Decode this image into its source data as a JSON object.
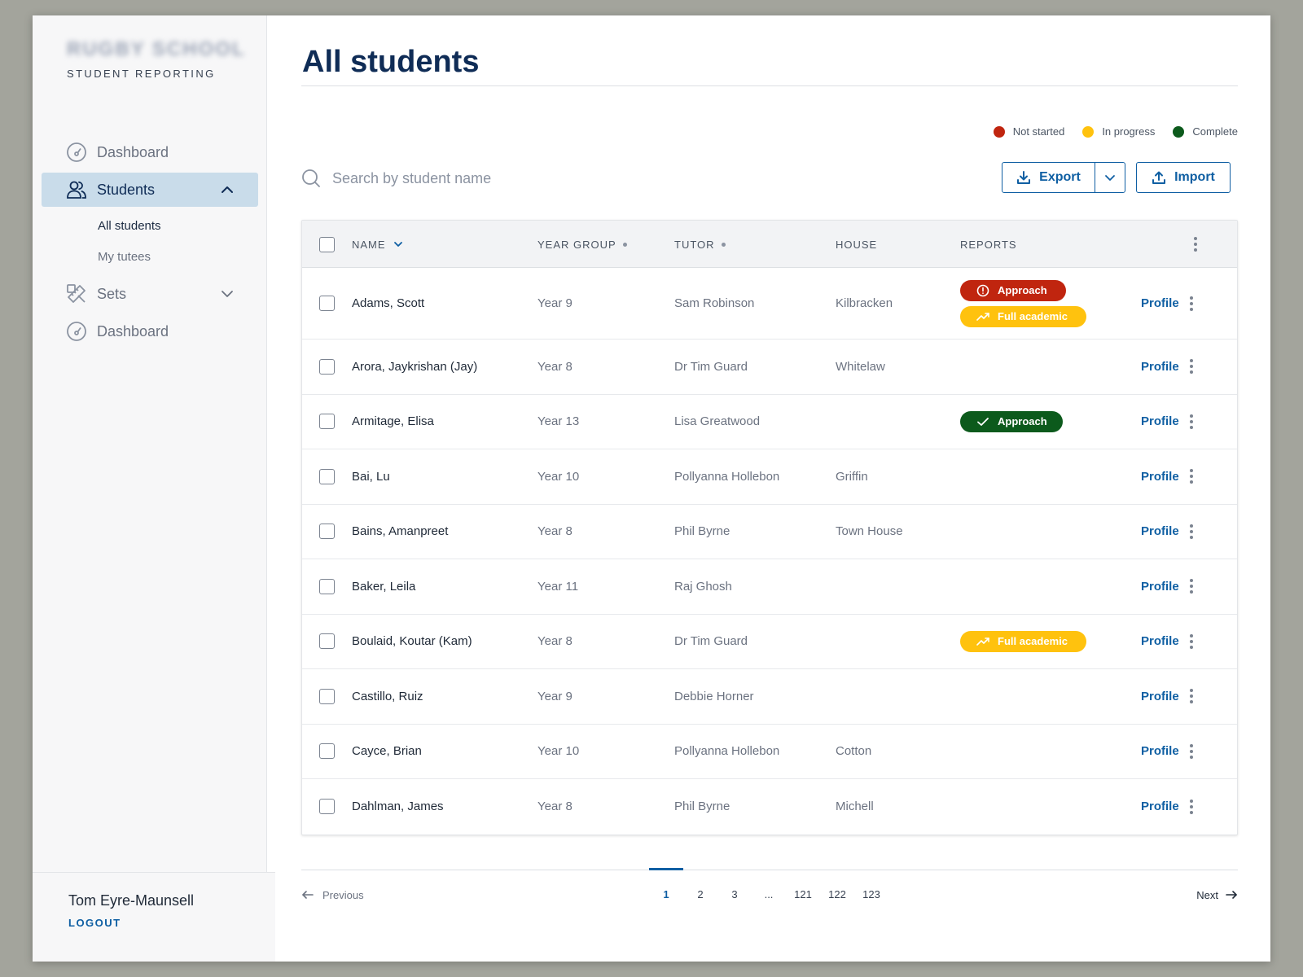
{
  "sidebar": {
    "brand_logo": "RUGBY SCHOOL",
    "brand_subtitle": "STUDENT REPORTING",
    "items": [
      {
        "label": "Dashboard",
        "icon": "gauge-icon"
      },
      {
        "label": "Students",
        "icon": "users-icon",
        "expanded": true
      },
      {
        "label": "Sets",
        "icon": "pencil-ruler-icon",
        "expanded": false
      },
      {
        "label": "Dashboard",
        "icon": "gauge-icon"
      }
    ],
    "sub_items": [
      {
        "label": "All students",
        "active": true
      },
      {
        "label": "My tutees",
        "active": false
      }
    ],
    "user_name": "Tom Eyre-Maunsell",
    "logout_label": "LOGOUT"
  },
  "main": {
    "title": "All students",
    "legend": [
      {
        "label": "Not started",
        "color": "#c0250f"
      },
      {
        "label": "In progress",
        "color": "#ffc20e"
      },
      {
        "label": "Complete",
        "color": "#0c5a1c"
      }
    ],
    "search_placeholder": "Search by student name",
    "export_label": "Export",
    "import_label": "Import",
    "columns": {
      "name": "NAME",
      "year_group": "YEAR GROUP",
      "tutor": "TUTOR",
      "house": "HOUSE",
      "reports": "REPORTS"
    },
    "profile_label": "Profile",
    "rows": [
      {
        "name": "Adams, Scott",
        "year": "Year 9",
        "tutor": "Sam Robinson",
        "house": "Kilbracken",
        "reports": [
          {
            "label": "Approach",
            "status": "not-started"
          },
          {
            "label": "Full academic",
            "status": "in-progress"
          }
        ]
      },
      {
        "name": "Arora, Jaykrishan (Jay)",
        "year": "Year 8",
        "tutor": "Dr Tim Guard",
        "house": "Whitelaw",
        "reports": []
      },
      {
        "name": "Armitage, Elisa",
        "year": "Year 13",
        "tutor": "Lisa Greatwood",
        "house": "",
        "reports": [
          {
            "label": "Approach",
            "status": "complete"
          }
        ]
      },
      {
        "name": "Bai, Lu",
        "year": "Year 10",
        "tutor": "Pollyanna Hollebon",
        "house": "Griffin",
        "reports": []
      },
      {
        "name": "Bains, Amanpreet",
        "year": "Year 8",
        "tutor": "Phil Byrne",
        "house": "Town House",
        "reports": []
      },
      {
        "name": "Baker, Leila",
        "year": "Year 11",
        "tutor": "Raj Ghosh",
        "house": "",
        "reports": []
      },
      {
        "name": "Boulaid, Koutar (Kam)",
        "year": "Year 8",
        "tutor": "Dr Tim Guard",
        "house": "",
        "reports": [
          {
            "label": "Full academic",
            "status": "in-progress"
          }
        ]
      },
      {
        "name": "Castillo, Ruiz",
        "year": "Year 9",
        "tutor": "Debbie Horner",
        "house": "",
        "reports": []
      },
      {
        "name": "Cayce, Brian",
        "year": "Year 10",
        "tutor": "Pollyanna Hollebon",
        "house": "Cotton",
        "reports": []
      },
      {
        "name": "Dahlman, James",
        "year": "Year 8",
        "tutor": "Phil Byrne",
        "house": "Michell",
        "reports": []
      }
    ],
    "pagination": {
      "previous_label": "Previous",
      "next_label": "Next",
      "pages": [
        "1",
        "2",
        "3",
        "...",
        "121",
        "122",
        "123"
      ],
      "current": "1"
    }
  }
}
